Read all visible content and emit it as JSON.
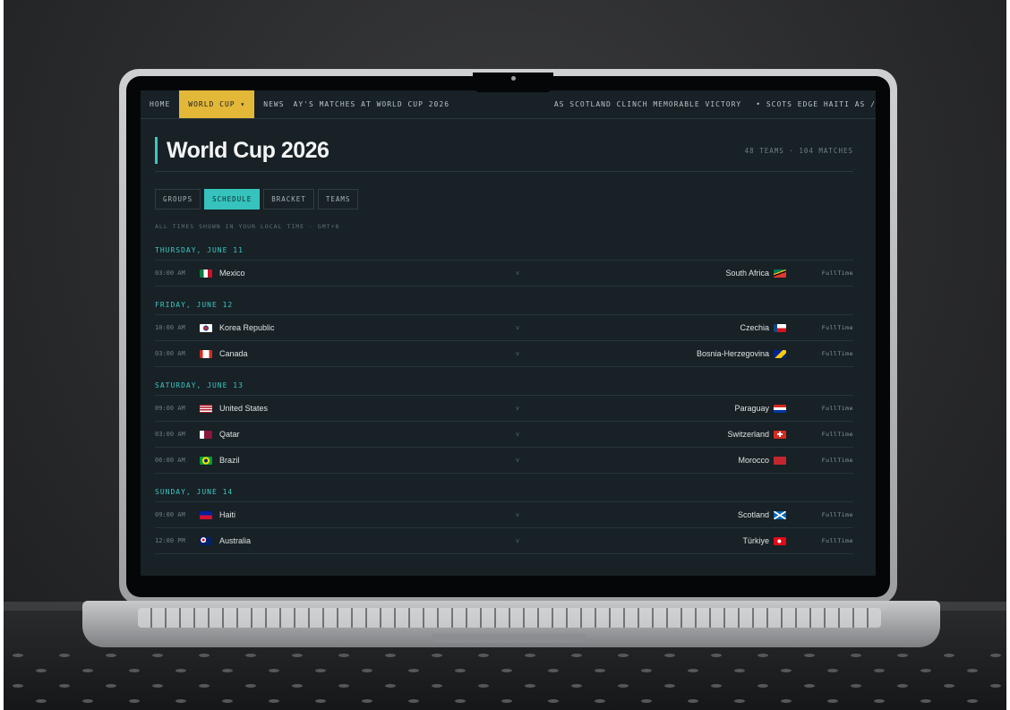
{
  "nav": {
    "items": [
      "HOME",
      "WORLD CUP ▾",
      "NEWS"
    ],
    "active_index": 1,
    "ticker": [
      "AY'S MATCHES AT WORLD CUP 2026",
      "AS SCOTLAND CLINCH MEMORABLE VICTORY",
      "• SCOTS EDGE HAITI AS /"
    ]
  },
  "header": {
    "title": "World Cup 2026",
    "stats": "48 TEAMS · 104 MATCHES"
  },
  "tabs": [
    {
      "label": "GROUPS",
      "active": false
    },
    {
      "label": "SCHEDULE",
      "active": true
    },
    {
      "label": "BRACKET",
      "active": false
    },
    {
      "label": "TEAMS",
      "active": false
    }
  ],
  "timezone_note": "ALL TIMES SHOWN IN YOUR LOCAL TIME · GMT+8",
  "days": [
    {
      "label": "THURSDAY, JUNE 11",
      "matches": [
        {
          "time": "03:00 AM",
          "home": "Mexico",
          "home_flag": "mexico-flag-icon",
          "away": "South Africa",
          "away_flag": "south-africa-flag-icon",
          "vs": "v",
          "status": "FullTime"
        }
      ]
    },
    {
      "label": "FRIDAY, JUNE 12",
      "matches": [
        {
          "time": "10:00 AM",
          "home": "Korea Republic",
          "home_flag": "korea-flag-icon",
          "away": "Czechia",
          "away_flag": "czechia-flag-icon",
          "vs": "v",
          "status": "FullTime"
        },
        {
          "time": "03:00 AM",
          "home": "Canada",
          "home_flag": "canada-flag-icon",
          "away": "Bosnia-Herzegovina",
          "away_flag": "bosnia-flag-icon",
          "vs": "v",
          "status": "FullTime"
        }
      ]
    },
    {
      "label": "SATURDAY, JUNE 13",
      "matches": [
        {
          "time": "09:00 AM",
          "home": "United States",
          "home_flag": "usa-flag-icon",
          "away": "Paraguay",
          "away_flag": "paraguay-flag-icon",
          "vs": "v",
          "status": "FullTime"
        },
        {
          "time": "03:00 AM",
          "home": "Qatar",
          "home_flag": "qatar-flag-icon",
          "away": "Switzerland",
          "away_flag": "switzerland-flag-icon",
          "vs": "v",
          "status": "FullTime"
        },
        {
          "time": "06:00 AM",
          "home": "Brazil",
          "home_flag": "brazil-flag-icon",
          "away": "Morocco",
          "away_flag": "morocco-flag-icon",
          "vs": "v",
          "status": "FullTime"
        }
      ]
    },
    {
      "label": "SUNDAY, JUNE 14",
      "matches": [
        {
          "time": "09:00 AM",
          "home": "Haiti",
          "home_flag": "haiti-flag-icon",
          "away": "Scotland",
          "away_flag": "scotland-flag-icon",
          "vs": "v",
          "status": "FullTime"
        },
        {
          "time": "12:00 PM",
          "home": "Australia",
          "home_flag": "australia-flag-icon",
          "away": "Türkiye",
          "away_flag": "turkiye-flag-icon",
          "vs": "v",
          "status": "FullTime"
        }
      ]
    }
  ],
  "colors": {
    "accent_teal": "#3ec7c2",
    "nav_active": "#e3b738",
    "background": "#172126"
  }
}
